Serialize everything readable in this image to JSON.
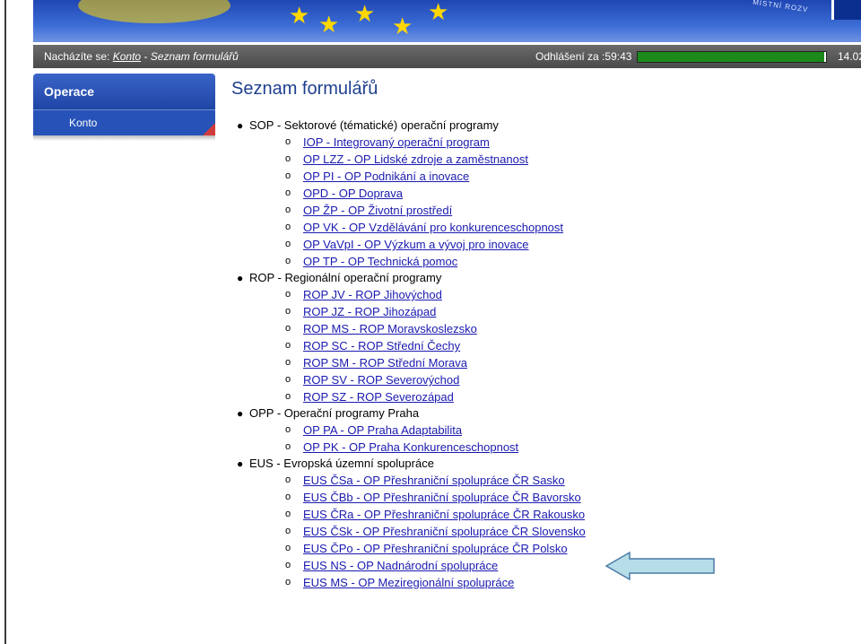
{
  "colors": {
    "banner": "#2a54c0",
    "navbar": "#555555",
    "progress_fill": "#1b8a1b",
    "link": "#1a1ab0",
    "title": "#1f3f8f",
    "sidebar": "#2753b8",
    "arrow_fill": "#b7dde8",
    "arrow_stroke": "#4a7ba6"
  },
  "banner": {
    "motto": "MÍSTNÍ ROZV"
  },
  "nav": {
    "location_prefix": "Nacházíte se:",
    "crumb_link": "Konto",
    "crumb_separator": "-",
    "crumb_current": "Seznam formulářů",
    "logout_label": "Odhlášení za :",
    "logout_timer": "59:43",
    "session_progress_fraction": 0.99,
    "session_time": "14.02"
  },
  "sidebar": {
    "title": "Operace",
    "items": [
      {
        "label": "Konto"
      }
    ]
  },
  "page": {
    "title": "Seznam formulářů",
    "groups": [
      {
        "label": "SOP - Sektorové (tématické) operační programy",
        "items": [
          "IOP - Integrovaný operační program",
          "OP LZZ - OP Lidské zdroje a zaměstnanost",
          "OP PI - OP Podnikání a inovace",
          "OPD - OP Doprava",
          "OP ŽP - OP Životní prostředí",
          "OP VK - OP Vzdělávání pro konkurenceschopnost",
          "OP VaVpI - OP Výzkum a vývoj pro inovace",
          "OP TP - OP Technická pomoc"
        ]
      },
      {
        "label": "ROP - Regionální operační programy",
        "items": [
          "ROP JV - ROP Jihovýchod",
          "ROP JZ - ROP Jihozápad",
          "ROP MS - ROP Moravskoslezsko",
          "ROP SC - ROP Střední Čechy",
          "ROP SM - ROP Střední Morava",
          "ROP SV - ROP Severovýchod",
          "ROP SZ - ROP Severozápad"
        ]
      },
      {
        "label": "OPP - Operační programy Praha",
        "items": [
          "OP PA - OP Praha Adaptabilita",
          "OP PK - OP Praha Konkurenceschopnost"
        ]
      },
      {
        "label": "EUS - Evropská územní spolupráce",
        "items": [
          "EUS ČSa - OP Přeshraniční spolupráce ČR Sasko",
          "EUS ČBb - OP Přeshraniční spolupráce ČR Bavorsko",
          "EUS ČRa - OP Přeshraniční spolupráce ČR Rakousko",
          "EUS ČSk - OP Přeshraniční spolupráce ČR Slovensko",
          "EUS ČPo - OP Přeshraniční spolupráce ČR Polsko",
          "EUS NS - OP Nadnárodní spolupráce",
          "EUS MS - OP Meziregionální spolupráce"
        ]
      }
    ]
  },
  "annotation": {
    "icon": "left-arrow-icon",
    "points_to_item": "EUS ČPo - OP Přeshraniční spolupráce ČR Polsko"
  }
}
